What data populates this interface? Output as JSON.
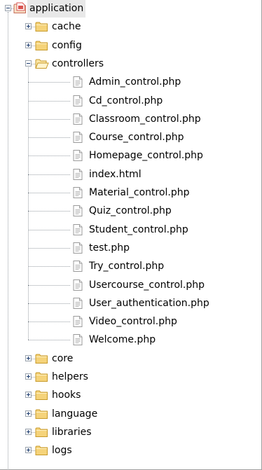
{
  "tree": {
    "root": {
      "label": "application",
      "expanded": true,
      "icon": "project-folder-icon"
    },
    "children": [
      {
        "label": "cache",
        "type": "folder",
        "expanded": false
      },
      {
        "label": "config",
        "type": "folder",
        "expanded": false
      },
      {
        "label": "controllers",
        "type": "folder",
        "expanded": true,
        "children": [
          {
            "label": "Admin_control.php",
            "type": "file"
          },
          {
            "label": "Cd_control.php",
            "type": "file"
          },
          {
            "label": "Classroom_control.php",
            "type": "file"
          },
          {
            "label": "Course_control.php",
            "type": "file"
          },
          {
            "label": "Homepage_control.php",
            "type": "file"
          },
          {
            "label": "index.html",
            "type": "file"
          },
          {
            "label": "Material_control.php",
            "type": "file"
          },
          {
            "label": "Quiz_control.php",
            "type": "file"
          },
          {
            "label": "Student_control.php",
            "type": "file"
          },
          {
            "label": "test.php",
            "type": "file"
          },
          {
            "label": "Try_control.php",
            "type": "file"
          },
          {
            "label": "Usercourse_control.php",
            "type": "file"
          },
          {
            "label": "User_authentication.php",
            "type": "file"
          },
          {
            "label": "Video_control.php",
            "type": "file"
          },
          {
            "label": "Welcome.php",
            "type": "file"
          }
        ]
      },
      {
        "label": "core",
        "type": "folder",
        "expanded": false
      },
      {
        "label": "helpers",
        "type": "folder",
        "expanded": false
      },
      {
        "label": "hooks",
        "type": "folder",
        "expanded": false
      },
      {
        "label": "language",
        "type": "folder",
        "expanded": false
      },
      {
        "label": "libraries",
        "type": "folder",
        "expanded": false
      },
      {
        "label": "logs",
        "type": "folder",
        "expanded": false
      }
    ]
  },
  "colors": {
    "folder": "#f5d37a",
    "folder_open": "#fbe6a6",
    "project_folder_accent": "#d9534f",
    "tree_lines": "#9aa0a6",
    "expander_border": "#9aa3ad",
    "selection": "#e8e8e8"
  }
}
